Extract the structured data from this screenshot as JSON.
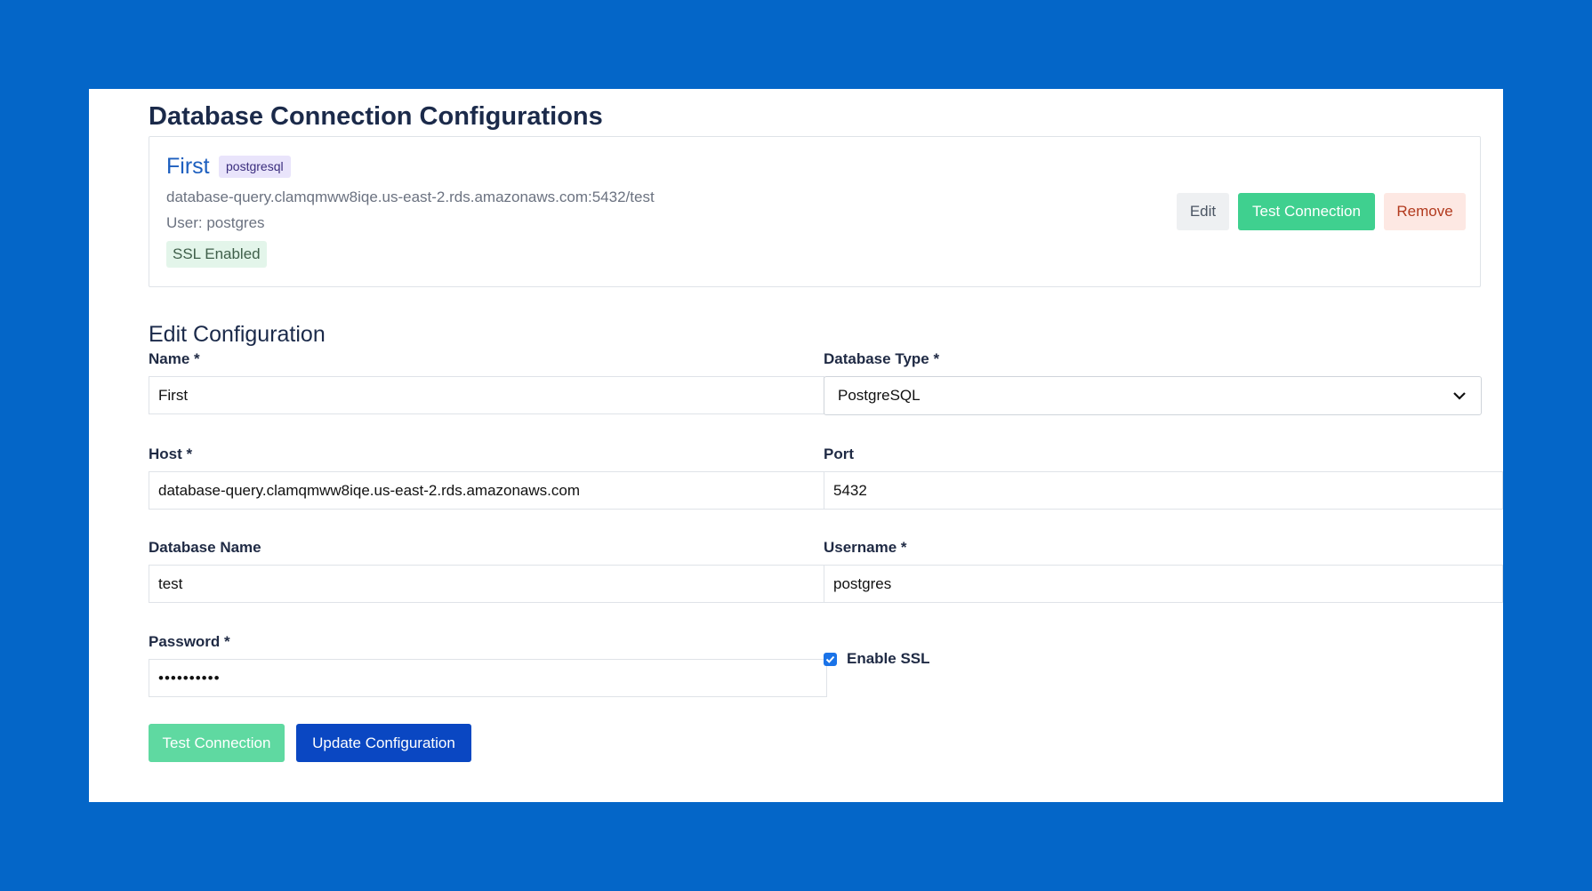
{
  "page": {
    "title": "Database Connection Configurations"
  },
  "connection": {
    "name": "First",
    "type_badge": "postgresql",
    "host_line": "database-query.clamqmww8iqe.us-east-2.rds.amazonaws.com:5432/test",
    "user_line": "User: postgres",
    "ssl_badge": "SSL Enabled",
    "actions": {
      "edit": "Edit",
      "test": "Test Connection",
      "remove": "Remove"
    }
  },
  "form": {
    "title": "Edit Configuration",
    "name": {
      "label": "Name *",
      "value": "First"
    },
    "db_type": {
      "label": "Database Type *",
      "value": "PostgreSQL"
    },
    "host": {
      "label": "Host *",
      "value": "database-query.clamqmww8iqe.us-east-2.rds.amazonaws.com"
    },
    "port": {
      "label": "Port",
      "value": "5432"
    },
    "db_name": {
      "label": "Database Name",
      "value": "test"
    },
    "username": {
      "label": "Username *",
      "value": "postgres"
    },
    "password": {
      "label": "Password *",
      "value": "••••••••••"
    },
    "ssl": {
      "label": "Enable SSL",
      "checked": true
    },
    "buttons": {
      "test": "Test Connection",
      "update": "Update Configuration"
    }
  },
  "colors": {
    "background": "#0466c8",
    "test_button": "#3fd08f",
    "update_button": "#0a47c2",
    "remove_text": "#b23a1e"
  }
}
